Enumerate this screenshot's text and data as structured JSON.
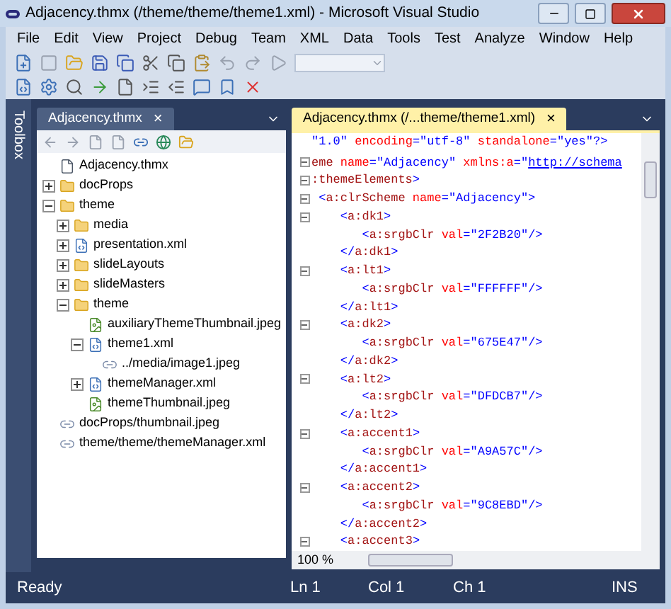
{
  "window": {
    "title": "Adjacency.thmx (/theme/theme/theme1.xml) - Microsoft Visual Studio"
  },
  "menu": [
    "File",
    "Edit",
    "View",
    "Project",
    "Debug",
    "Team",
    "XML",
    "Data",
    "Tools",
    "Test",
    "Analyze",
    "Window",
    "Help"
  ],
  "toolbox": {
    "label": "Toolbox"
  },
  "explorer": {
    "tab": {
      "label": "Adjacency.thmx",
      "close": "×",
      "selected": false
    },
    "tree": [
      {
        "label": "Adjacency.thmx",
        "kind": "file"
      },
      {
        "label": "docProps",
        "kind": "folder",
        "expanded": false
      },
      {
        "label": "theme",
        "kind": "folder",
        "expanded": true,
        "children": [
          {
            "label": "media",
            "kind": "folder",
            "expanded": false
          },
          {
            "label": "presentation.xml",
            "kind": "xml",
            "expanded": false
          },
          {
            "label": "slideLayouts",
            "kind": "folder",
            "expanded": false
          },
          {
            "label": "slideMasters",
            "kind": "folder",
            "expanded": false
          },
          {
            "label": "theme",
            "kind": "folder",
            "expanded": true,
            "children": [
              {
                "label": "auxiliaryThemeThumbnail.jpeg",
                "kind": "image"
              },
              {
                "label": "theme1.xml",
                "kind": "xml",
                "expanded": true,
                "children": [
                  {
                    "label": "../media/image1.jpeg",
                    "kind": "link"
                  }
                ]
              },
              {
                "label": "themeManager.xml",
                "kind": "xml",
                "expanded": false
              },
              {
                "label": "themeThumbnail.jpeg",
                "kind": "image"
              }
            ]
          }
        ]
      },
      {
        "label": "docProps/thumbnail.jpeg",
        "kind": "link"
      },
      {
        "label": "theme/theme/themeManager.xml",
        "kind": "link"
      }
    ]
  },
  "editor": {
    "tab": {
      "label": "Adjacency.thmx (/...theme/theme1.xml)",
      "close": "×",
      "selected": true
    },
    "lines": [
      {
        "fold": false,
        "segments": [
          {
            "text": "\"1.0\"",
            "kind": "value"
          },
          {
            "text": " encoding",
            "kind": "attr"
          },
          {
            "text": "=",
            "kind": "punct"
          },
          {
            "text": "\"utf-8\"",
            "kind": "value"
          },
          {
            "text": " standalone",
            "kind": "attr"
          },
          {
            "text": "=",
            "kind": "punct"
          },
          {
            "text": "\"yes\"",
            "kind": "value"
          },
          {
            "text": "?>",
            "kind": "punct"
          }
        ]
      },
      {
        "fold": false
      },
      {
        "fold": true,
        "segments": [
          {
            "text": "eme",
            "kind": "tag"
          },
          {
            "text": " name",
            "kind": "attr"
          },
          {
            "text": "=",
            "kind": "punct"
          },
          {
            "text": "\"Adjacency\"",
            "kind": "value"
          },
          {
            "text": " xmlns:a",
            "kind": "attr"
          },
          {
            "text": "=",
            "kind": "punct"
          },
          {
            "text": "\"",
            "kind": "value"
          },
          {
            "text": "http://schema",
            "kind": "link"
          }
        ]
      },
      {
        "fold": true,
        "segments": [
          {
            "text": ":themeElements",
            "kind": "tag"
          },
          {
            "text": ">",
            "kind": "punct"
          }
        ]
      },
      {
        "fold": true,
        "segments": [
          {
            "text": " <",
            "kind": "punct"
          },
          {
            "text": "a:clrScheme",
            "kind": "tag"
          },
          {
            "text": " name",
            "kind": "attr"
          },
          {
            "text": "=",
            "kind": "punct"
          },
          {
            "text": "\"Adjacency\"",
            "kind": "value"
          },
          {
            "text": ">",
            "kind": "punct"
          }
        ]
      },
      {
        "fold": true,
        "segments": [
          {
            "text": "    <",
            "kind": "punct"
          },
          {
            "text": "a:dk1",
            "kind": "tag"
          },
          {
            "text": ">",
            "kind": "punct"
          }
        ]
      },
      {
        "fold": false,
        "segments": [
          {
            "text": "       <",
            "kind": "punct"
          },
          {
            "text": "a:srgbClr",
            "kind": "tag"
          },
          {
            "text": " val",
            "kind": "attr"
          },
          {
            "text": "=",
            "kind": "punct"
          },
          {
            "text": "\"2F2B20\"",
            "kind": "value"
          },
          {
            "text": "/>",
            "kind": "punct"
          }
        ]
      },
      {
        "fold": false,
        "segments": [
          {
            "text": "    </",
            "kind": "punct"
          },
          {
            "text": "a:dk1",
            "kind": "tag"
          },
          {
            "text": ">",
            "kind": "punct"
          }
        ]
      },
      {
        "fold": true,
        "segments": [
          {
            "text": "    <",
            "kind": "punct"
          },
          {
            "text": "a:lt1",
            "kind": "tag"
          },
          {
            "text": ">",
            "kind": "punct"
          }
        ]
      },
      {
        "fold": false,
        "segments": [
          {
            "text": "       <",
            "kind": "punct"
          },
          {
            "text": "a:srgbClr",
            "kind": "tag"
          },
          {
            "text": " val",
            "kind": "attr"
          },
          {
            "text": "=",
            "kind": "punct"
          },
          {
            "text": "\"FFFFFF\"",
            "kind": "value"
          },
          {
            "text": "/>",
            "kind": "punct"
          }
        ]
      },
      {
        "fold": false,
        "segments": [
          {
            "text": "    </",
            "kind": "punct"
          },
          {
            "text": "a:lt1",
            "kind": "tag"
          },
          {
            "text": ">",
            "kind": "punct"
          }
        ]
      },
      {
        "fold": true,
        "segments": [
          {
            "text": "    <",
            "kind": "punct"
          },
          {
            "text": "a:dk2",
            "kind": "tag"
          },
          {
            "text": ">",
            "kind": "punct"
          }
        ]
      },
      {
        "fold": false,
        "segments": [
          {
            "text": "       <",
            "kind": "punct"
          },
          {
            "text": "a:srgbClr",
            "kind": "tag"
          },
          {
            "text": " val",
            "kind": "attr"
          },
          {
            "text": "=",
            "kind": "punct"
          },
          {
            "text": "\"675E47\"",
            "kind": "value"
          },
          {
            "text": "/>",
            "kind": "punct"
          }
        ]
      },
      {
        "fold": false,
        "segments": [
          {
            "text": "    </",
            "kind": "punct"
          },
          {
            "text": "a:dk2",
            "kind": "tag"
          },
          {
            "text": ">",
            "kind": "punct"
          }
        ]
      },
      {
        "fold": true,
        "segments": [
          {
            "text": "    <",
            "kind": "punct"
          },
          {
            "text": "a:lt2",
            "kind": "tag"
          },
          {
            "text": ">",
            "kind": "punct"
          }
        ]
      },
      {
        "fold": false,
        "segments": [
          {
            "text": "       <",
            "kind": "punct"
          },
          {
            "text": "a:srgbClr",
            "kind": "tag"
          },
          {
            "text": " val",
            "kind": "attr"
          },
          {
            "text": "=",
            "kind": "punct"
          },
          {
            "text": "\"DFDCB7\"",
            "kind": "value"
          },
          {
            "text": "/>",
            "kind": "punct"
          }
        ]
      },
      {
        "fold": false,
        "segments": [
          {
            "text": "    </",
            "kind": "punct"
          },
          {
            "text": "a:lt2",
            "kind": "tag"
          },
          {
            "text": ">",
            "kind": "punct"
          }
        ]
      },
      {
        "fold": true,
        "segments": [
          {
            "text": "    <",
            "kind": "punct"
          },
          {
            "text": "a:accent1",
            "kind": "tag"
          },
          {
            "text": ">",
            "kind": "punct"
          }
        ]
      },
      {
        "fold": false,
        "segments": [
          {
            "text": "       <",
            "kind": "punct"
          },
          {
            "text": "a:srgbClr",
            "kind": "tag"
          },
          {
            "text": " val",
            "kind": "attr"
          },
          {
            "text": "=",
            "kind": "punct"
          },
          {
            "text": "\"A9A57C\"",
            "kind": "value"
          },
          {
            "text": "/>",
            "kind": "punct"
          }
        ]
      },
      {
        "fold": false,
        "segments": [
          {
            "text": "    </",
            "kind": "punct"
          },
          {
            "text": "a:accent1",
            "kind": "tag"
          },
          {
            "text": ">",
            "kind": "punct"
          }
        ]
      },
      {
        "fold": true,
        "segments": [
          {
            "text": "    <",
            "kind": "punct"
          },
          {
            "text": "a:accent2",
            "kind": "tag"
          },
          {
            "text": ">",
            "kind": "punct"
          }
        ]
      },
      {
        "fold": false,
        "segments": [
          {
            "text": "       <",
            "kind": "punct"
          },
          {
            "text": "a:srgbClr",
            "kind": "tag"
          },
          {
            "text": " val",
            "kind": "attr"
          },
          {
            "text": "=",
            "kind": "punct"
          },
          {
            "text": "\"9C8EBD\"",
            "kind": "value"
          },
          {
            "text": "/>",
            "kind": "punct"
          }
        ]
      },
      {
        "fold": false,
        "segments": [
          {
            "text": "    </",
            "kind": "punct"
          },
          {
            "text": "a:accent2",
            "kind": "tag"
          },
          {
            "text": ">",
            "kind": "punct"
          }
        ]
      },
      {
        "fold": true,
        "segments": [
          {
            "text": "    <",
            "kind": "punct"
          },
          {
            "text": "a:accent3",
            "kind": "tag"
          },
          {
            "text": ">",
            "kind": "punct"
          }
        ]
      }
    ],
    "zoom": "100 %"
  },
  "status_bar": {
    "message": "Ready",
    "line": "Ln 1",
    "column": "Col 1",
    "char": "Ch 1",
    "mode": "INS"
  }
}
